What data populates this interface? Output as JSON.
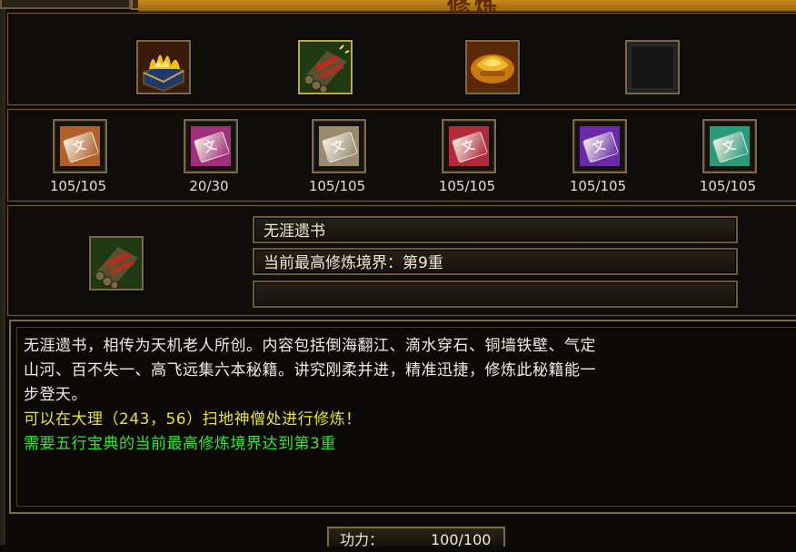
{
  "window": {
    "title": "修炼"
  },
  "top_icons": [
    {
      "name": "fire-book-icon",
      "colors": [
        "#e8c030",
        "#a83a10"
      ]
    },
    {
      "name": "bundle-icon",
      "colors": [
        "#3c5a20",
        "#b03020"
      ],
      "selected": true
    },
    {
      "name": "gold-ingot-icon",
      "colors": [
        "#f0b020",
        "#a05a10"
      ]
    },
    {
      "name": "empty-slot-icon",
      "colors": [
        "#1a1a1a",
        "#0a0a0a"
      ]
    }
  ],
  "scrolls": [
    {
      "name": "scroll-orange-icon",
      "color": "#b0602a",
      "count": "105/105"
    },
    {
      "name": "scroll-pink-icon",
      "color": "#a0307a",
      "count": "20/30"
    },
    {
      "name": "scroll-tan-icon",
      "color": "#9a8a70",
      "count": "105/105"
    },
    {
      "name": "scroll-red-icon",
      "color": "#b02a3a",
      "count": "105/105"
    },
    {
      "name": "scroll-purple-icon",
      "color": "#6a2aa8",
      "count": "105/105"
    },
    {
      "name": "scroll-teal-icon",
      "color": "#2a9a7a",
      "count": "105/105"
    }
  ],
  "selected_item": {
    "icon": "bundle-icon",
    "name": "无涯遗书",
    "realm": "当前最高修炼境界：第9重",
    "extra": ""
  },
  "description": {
    "line1": "无涯遗书，相传为天机老人所创。内容包括倒海翻江、滴水穿石、铜墙铁壁、气定",
    "line2": "山河、百不失一、高飞远集六本秘籍。讲究刚柔并进，精准迅捷，修炼此秘籍能一",
    "line3": "步登天。",
    "location": "可以在大理（243，56）扫地神僧处进行修炼！",
    "requirement": "需要五行宝典的当前最高修炼境界达到第3重",
    "colors": {
      "normal": "#f1eedf",
      "location": "#e8e23a",
      "requirement": "#39e23a"
    }
  },
  "footer": {
    "label": "功力：",
    "value": "100/100"
  }
}
